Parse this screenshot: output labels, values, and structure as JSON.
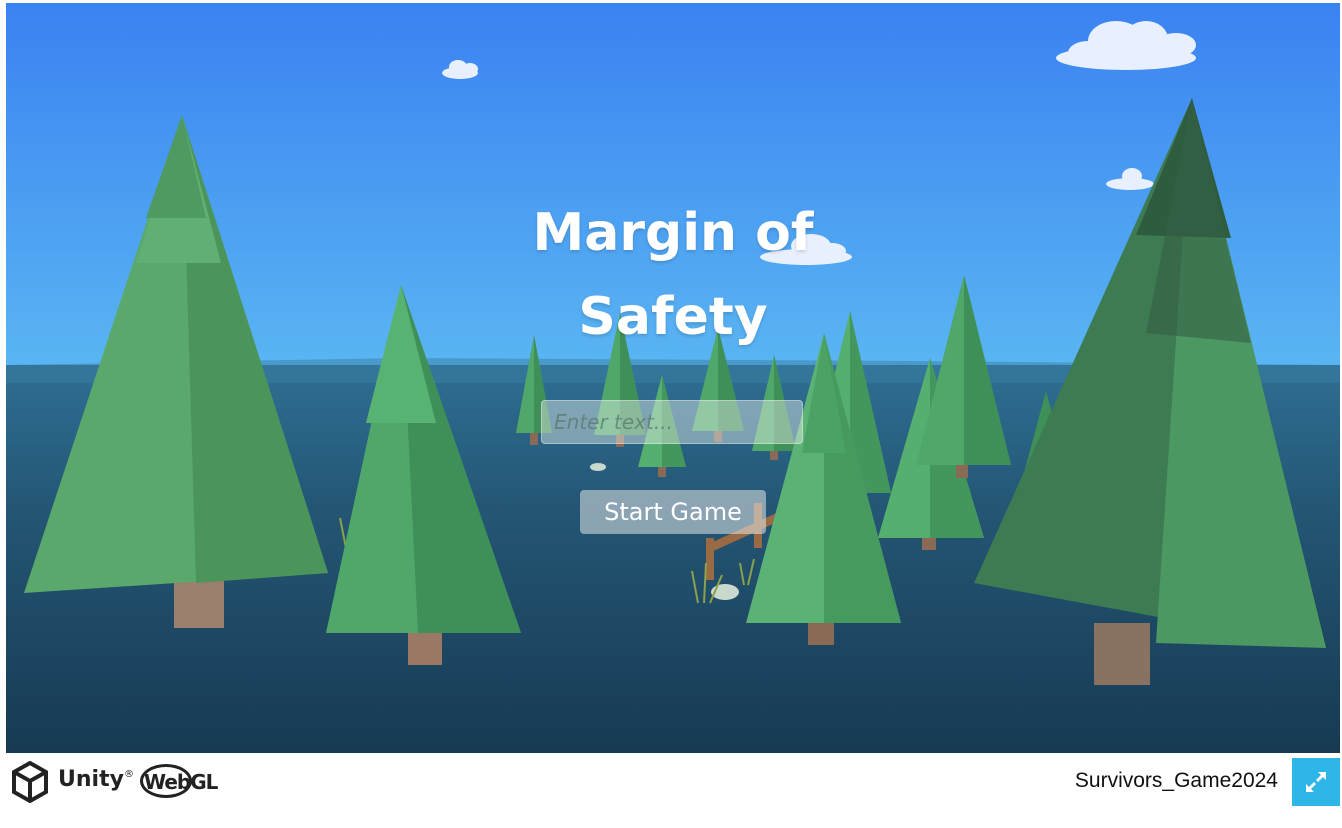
{
  "game": {
    "title_line1": "Margin of",
    "title_line2": "Safety",
    "input_placeholder": "Enter text...",
    "input_value": "",
    "start_button_label": "Start Game"
  },
  "footer": {
    "engine_label": "Unity",
    "engine_trademark": "®",
    "platform_label": "WebGL",
    "build_title": "Survivors_Game2024",
    "fullscreen_icon": "expand-arrows-icon",
    "accent_color": "#2fb6e8"
  },
  "scene": {
    "sky_color_top": "#3a82f2",
    "sky_color_horizon": "#5ab4f2",
    "water_color": "#1e4a66",
    "tree_color": "#4fa86a"
  }
}
